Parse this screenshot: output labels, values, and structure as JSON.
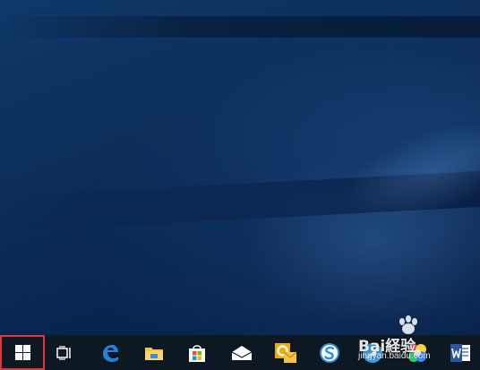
{
  "desktop": {
    "wallpaper": "windows-10-hero-blue",
    "colors": {
      "dark": "#061d41",
      "mid": "#0c2f5c",
      "light": "#3f78b8"
    }
  },
  "taskbar": {
    "background": "#0d1822",
    "start_button": {
      "icon": "windows-logo-icon",
      "highlight_color": "#e0353d"
    },
    "buttons": [
      {
        "name": "task-view",
        "icon": "task-view-icon"
      },
      {
        "name": "edge",
        "icon": "edge-browser-icon"
      },
      {
        "name": "file-explorer",
        "icon": "folder-icon"
      },
      {
        "name": "store",
        "icon": "store-bag-icon"
      },
      {
        "name": "mail",
        "icon": "mail-envelope-icon"
      },
      {
        "name": "outlook",
        "icon": "outlook-icon"
      },
      {
        "name": "sogou-browser",
        "icon": "s-browser-icon"
      },
      {
        "name": "feather-app",
        "icon": "feather-icon"
      },
      {
        "name": "color-app",
        "icon": "color-wheel-icon"
      },
      {
        "name": "word",
        "icon": "word-icon"
      }
    ]
  },
  "watermark": {
    "logo_text": "Bai経验",
    "url_text": "jingyan.baidu.com"
  }
}
